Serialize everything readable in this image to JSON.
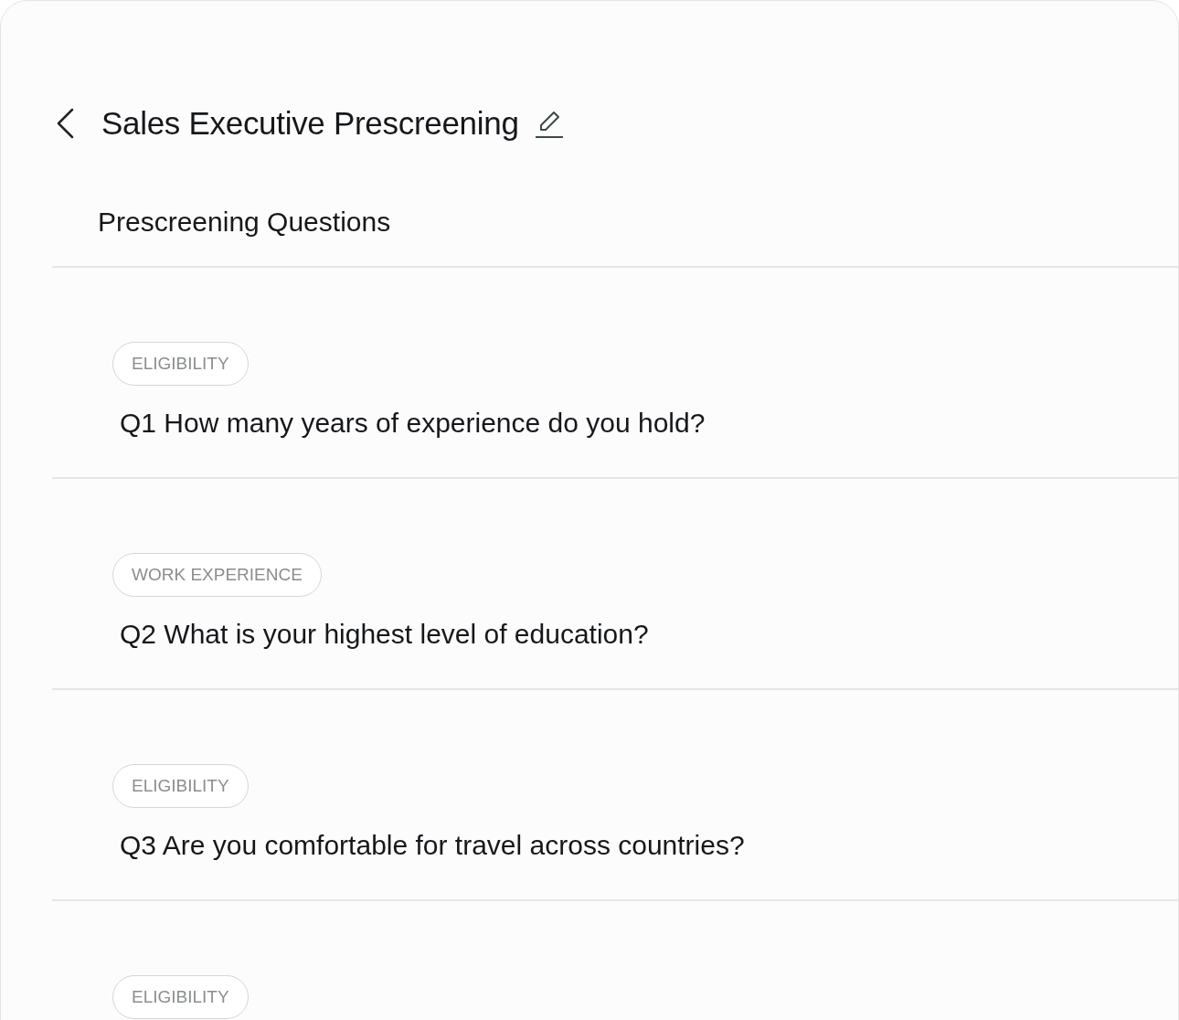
{
  "header": {
    "title": "Sales Executive Prescreening"
  },
  "section": {
    "title": "Prescreening Questions"
  },
  "questions": [
    {
      "tag": "ELIGIBILITY",
      "text": "Q1 How many years of experience do you hold?"
    },
    {
      "tag": "WORK EXPERIENCE",
      "text": "Q2 What is your highest level of education?"
    },
    {
      "tag": "ELIGIBILITY",
      "text": "Q3 Are you comfortable for travel across countries?"
    },
    {
      "tag": "ELIGIBILITY"
    }
  ]
}
